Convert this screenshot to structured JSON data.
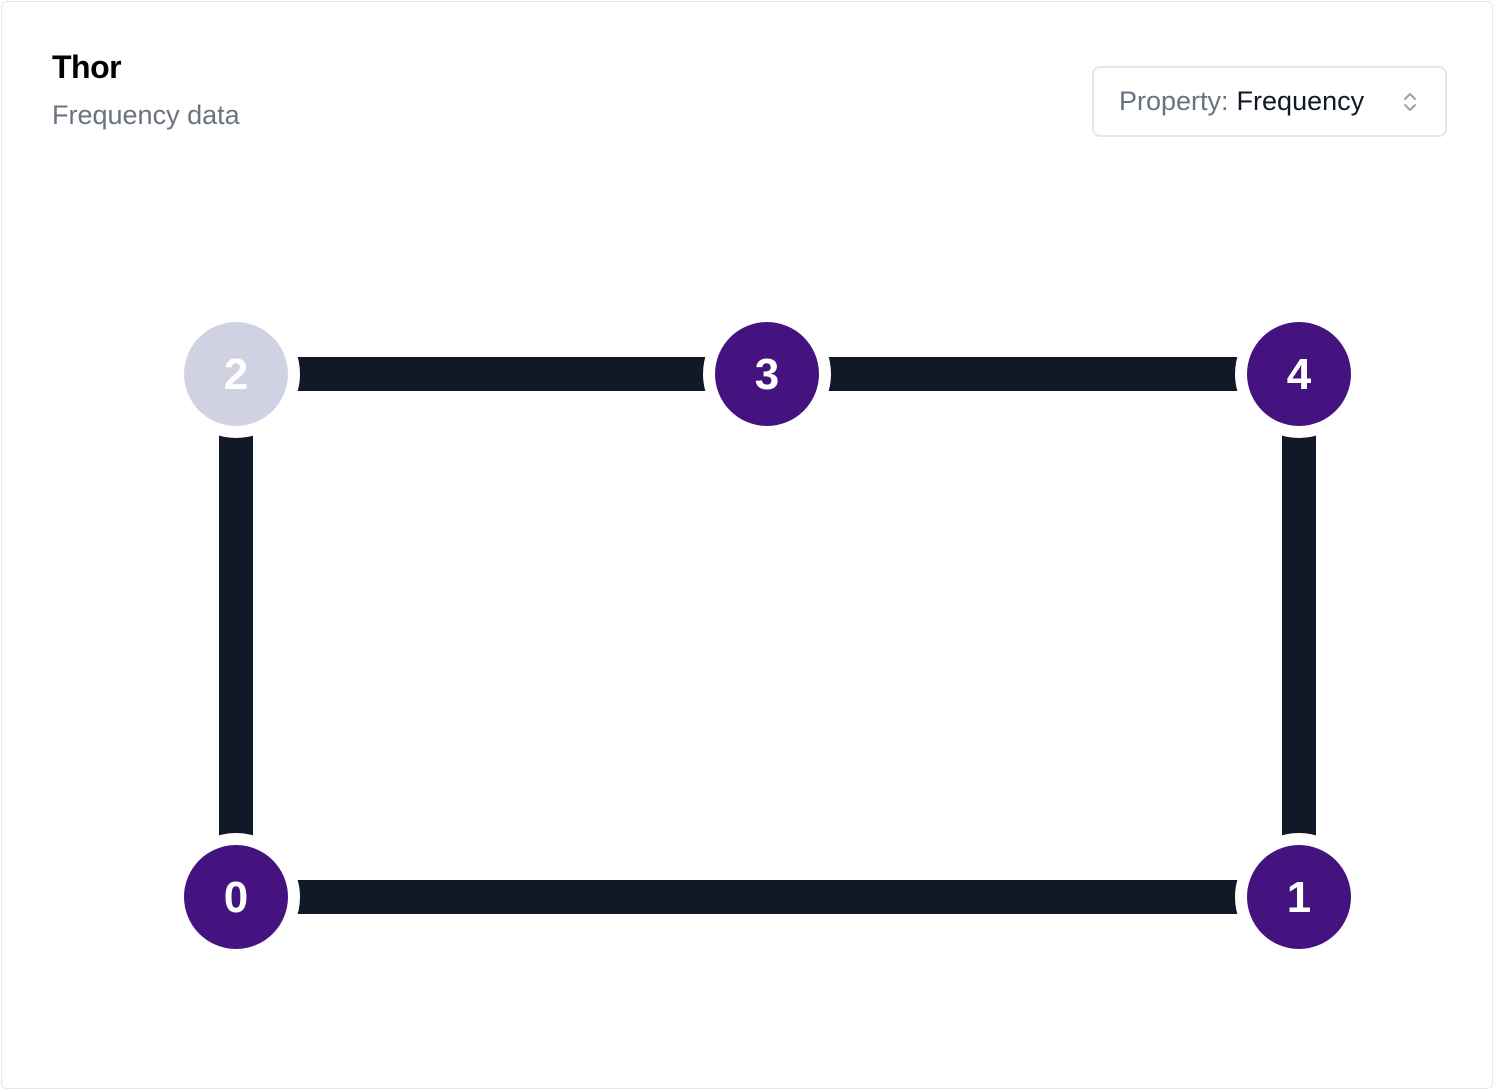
{
  "header": {
    "title": "Thor",
    "subtitle": "Frequency data"
  },
  "property_select": {
    "label": "Property:",
    "value": "Frequency",
    "icon": "chevron-up-down-icon"
  },
  "graph": {
    "colors": {
      "edge": "#111827",
      "node_active": "#44137f",
      "node_inactive": "#d1d1e4",
      "label": "#ffffff"
    },
    "nodes": [
      {
        "id": "0",
        "state": "active"
      },
      {
        "id": "1",
        "state": "active"
      },
      {
        "id": "2",
        "state": "inactive"
      },
      {
        "id": "3",
        "state": "active"
      },
      {
        "id": "4",
        "state": "active"
      }
    ],
    "edges": [
      [
        "0",
        "1"
      ],
      [
        "0",
        "2"
      ],
      [
        "1",
        "4"
      ],
      [
        "2",
        "3"
      ],
      [
        "3",
        "4"
      ]
    ]
  }
}
